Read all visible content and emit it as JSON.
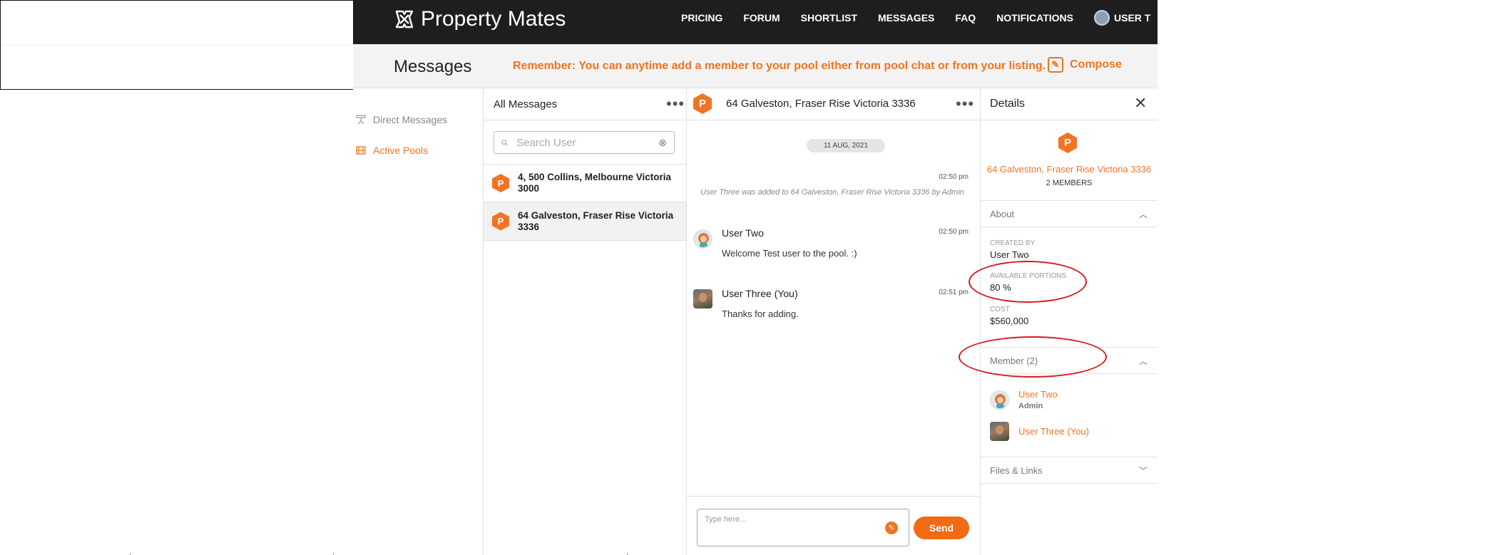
{
  "navbar": {
    "logo_text": "Property Mates",
    "links": [
      "PRICING",
      "FORUM",
      "SHORTLIST",
      "MESSAGES",
      "FAQ",
      "NOTIFICATIONS"
    ],
    "user_label": "USER T"
  },
  "subheader": {
    "title": "Messages",
    "reminder": "Remember: You can anytime add a member to your pool either from pool chat or from your listing.",
    "compose_label": "Compose"
  },
  "sidebar": {
    "items": [
      {
        "label": "Direct Messages",
        "active": false
      },
      {
        "label": "Active Pools",
        "active": true
      }
    ]
  },
  "inbox": {
    "title": "All Messages",
    "search_placeholder": "Search User",
    "conversations": [
      {
        "avatar_letter": "P",
        "title": "4, 500 Collins, Melbourne Victoria 3000",
        "selected": false
      },
      {
        "avatar_letter": "P",
        "title": "64 Galveston, Fraser Rise Victoria 3336",
        "selected": true
      }
    ]
  },
  "chat": {
    "avatar_letter": "P",
    "title": "64 Galveston, Fraser Rise Victoria 3336",
    "date_pill": "11 AUG, 2021",
    "system_time": "02:50 pm",
    "system_message": "User Three was added to 64 Galveston, Fraser Rise Victoria 3336 by Admin",
    "messages": [
      {
        "sender": "User Two",
        "time": "02:50 pm",
        "text": "Welcome Test user to the pool. :)"
      },
      {
        "sender": "User Three (You)",
        "time": "02:51 pm",
        "text": "Thanks for adding."
      }
    ],
    "input_placeholder": "Type here...",
    "send_label": "Send"
  },
  "details": {
    "title": "Details",
    "avatar_letter": "P",
    "pool_name": "64 Galveston, Fraser Rise Victoria 3336",
    "members_count_label": "2 MEMBERS",
    "about_label": "About",
    "created_by_label": "CREATED BY",
    "created_by_value": "User Two",
    "available_portions_label": "AVAILABLE PORTIONS",
    "available_portions_value": "80 %",
    "cost_label": "COST",
    "cost_value": "$560,000",
    "member_section_label": "Member (2)",
    "members": [
      {
        "name": "User Two",
        "role": "Admin"
      },
      {
        "name": "User Three (You)",
        "role": ""
      }
    ],
    "files_label": "Files & Links"
  },
  "colors": {
    "accent": "#f07423",
    "navbar_bg": "#1e1e1e",
    "annotation": "#d71a1a"
  }
}
